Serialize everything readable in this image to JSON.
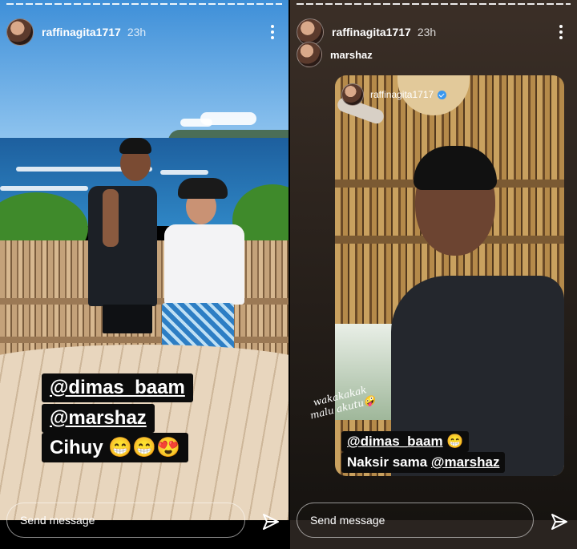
{
  "left_story": {
    "username": "raffinagita1717",
    "time": "23h",
    "caption": {
      "line1": "@dimas_baam",
      "line2": "@marshaz",
      "line3": "Cihuy 😁😁😍"
    },
    "send_placeholder": "Send message"
  },
  "right_story": {
    "username": "raffinagita1717",
    "time": "23h",
    "reshared_from": "marshaz",
    "inner_username": "raffinagita1717",
    "handwriting": "wakakakak malu akutu🤪",
    "caption": {
      "line1_mention": "@dimas_baam",
      "line1_emoji": "😁",
      "line2_text": "Naksir sama ",
      "line2_mention": "@marshaz"
    },
    "send_placeholder": "Send message"
  },
  "icons": {
    "more": "more-vertical-icon",
    "send": "paper-plane-icon",
    "verified": "verified-badge-icon"
  },
  "colors": {
    "caption_bg": "#0c0c0c",
    "verified": "#3897f0"
  }
}
